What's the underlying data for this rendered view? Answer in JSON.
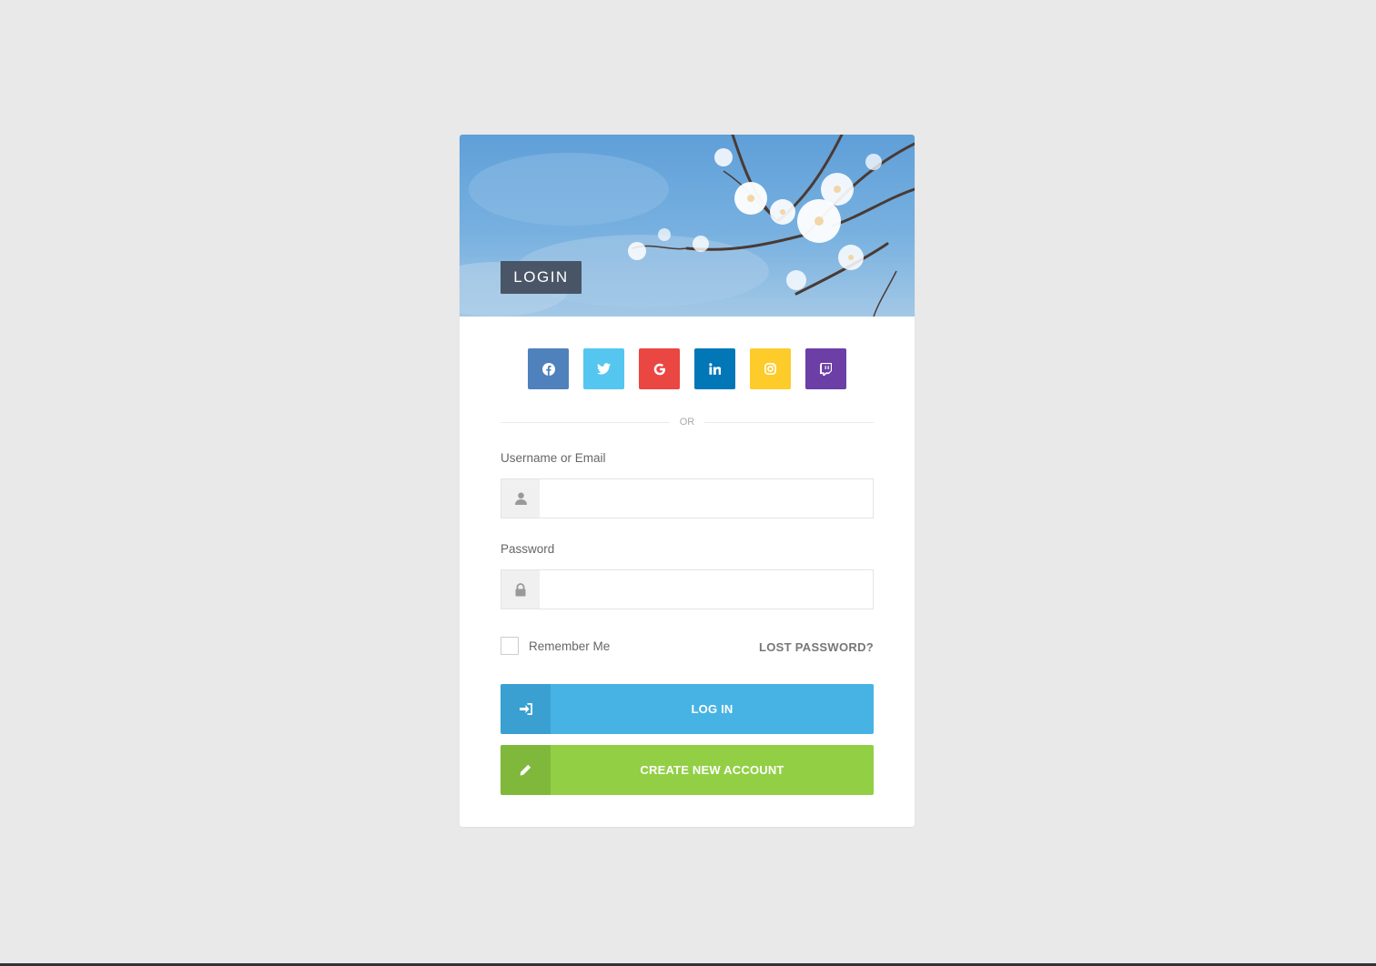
{
  "header": {
    "title": "LOGIN"
  },
  "social": [
    {
      "name": "facebook",
      "color": "#4f81bd",
      "icon": "facebook-icon"
    },
    {
      "name": "twitter",
      "color": "#55c6ef",
      "icon": "twitter-icon"
    },
    {
      "name": "google",
      "color": "#ea4642",
      "icon": "google-icon"
    },
    {
      "name": "linkedin",
      "color": "#0277b8",
      "icon": "linkedin-icon"
    },
    {
      "name": "instagram",
      "color": "#fdcc2a",
      "icon": "instagram-icon"
    },
    {
      "name": "twitch",
      "color": "#6b3fa6",
      "icon": "twitch-icon"
    }
  ],
  "divider_text": "OR",
  "form": {
    "username_label": "Username or Email",
    "username_value": "",
    "password_label": "Password",
    "password_value": "",
    "remember_label": "Remember Me",
    "remember_checked": false,
    "lost_password": "LOST PASSWORD?"
  },
  "buttons": {
    "login_label": "LOG IN",
    "login_color": "#47b3e4",
    "login_icon_color": "#3aa0d2",
    "create_label": "CREATE NEW ACCOUNT",
    "create_color": "#92cf45",
    "create_icon_color": "#7fb83a"
  }
}
